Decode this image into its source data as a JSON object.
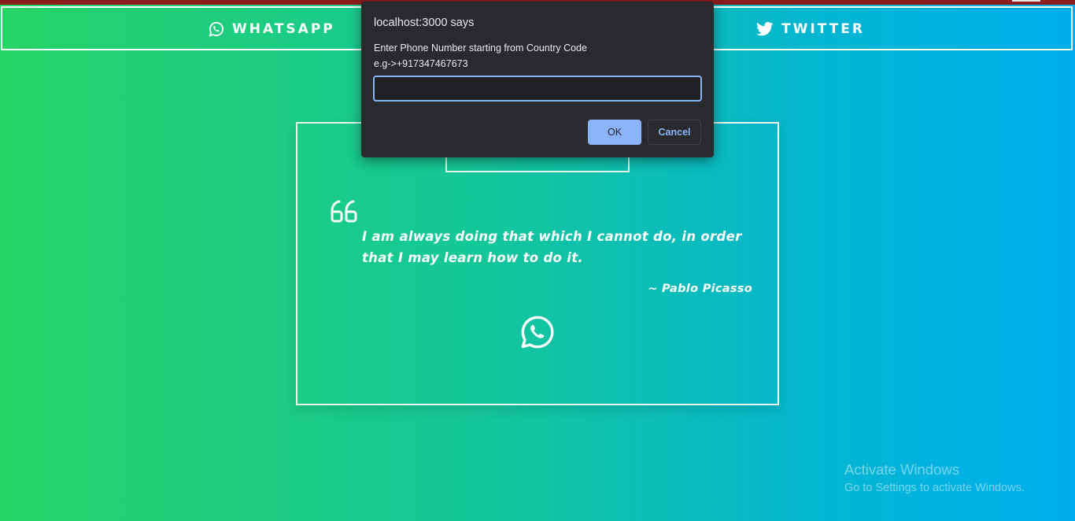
{
  "nav": {
    "items": [
      {
        "label": "WHATSAPP",
        "icon": "whatsapp-icon"
      },
      {
        "label": "TWITTER",
        "icon": "twitter-icon"
      }
    ]
  },
  "quote": {
    "text": "I am always doing that which I cannot do, in order that I may learn how to do it.",
    "author": "~ Pablo Picasso",
    "mark_icon": "quote-open-icon",
    "share_icon": "whatsapp-icon"
  },
  "dialog": {
    "title": "localhost:3000 says",
    "message_line1": "Enter Phone Number starting from Country Code",
    "message_line2": "e.g->+917347467673",
    "input_value": "",
    "ok_label": "OK",
    "cancel_label": "Cancel"
  },
  "watermark": {
    "title": "Activate Windows",
    "subtitle": "Go to Settings to activate Windows."
  },
  "colors": {
    "gradient_start": "#26d466",
    "gradient_end": "#00aeef",
    "dialog_bg": "#292a2d",
    "dialog_accent": "#8ab4f8",
    "top_strip": "#8b1c1c"
  }
}
